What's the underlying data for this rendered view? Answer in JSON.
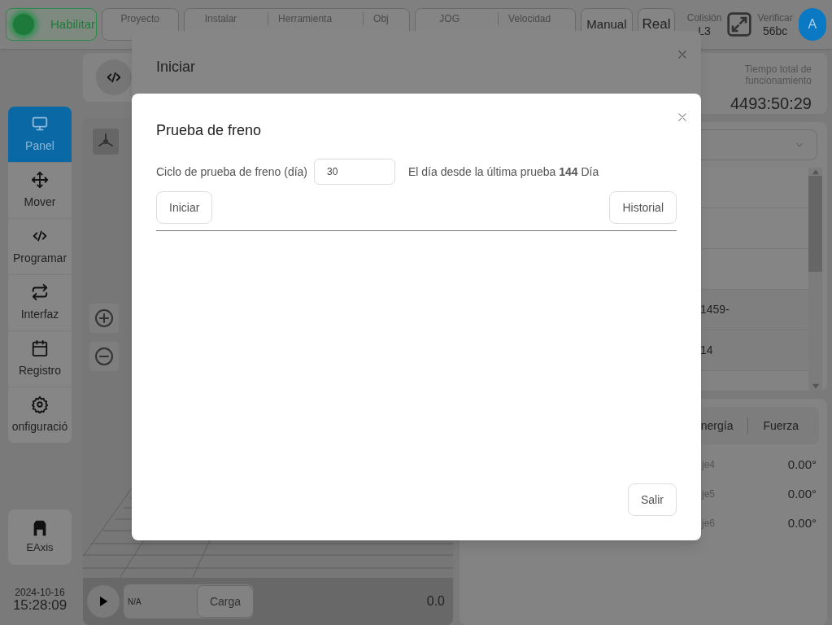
{
  "top_bar": {
    "enable_button": {
      "label": "Habilitar"
    },
    "status_groups": [
      {
        "items": [
          {
            "label": "Proyecto"
          }
        ]
      },
      {
        "items": [
          {
            "label": "Instalar"
          },
          {
            "label": "Herramienta"
          },
          {
            "label": "Obj"
          }
        ]
      },
      {
        "items": [
          {
            "label": "JOG"
          },
          {
            "label": "Velocidad"
          }
        ]
      }
    ],
    "mode_buttons": [
      {
        "label": "Manual",
        "kind": "small"
      },
      {
        "label": "Real",
        "kind": "large"
      }
    ],
    "collision": {
      "label": "Colisión",
      "value": "L3"
    },
    "verify": {
      "label": "Verificar",
      "value": "56bc"
    },
    "avatar": "A"
  },
  "sidebar": {
    "items": [
      {
        "label": "Panel",
        "selected": true
      },
      {
        "label": "Mover",
        "selected": false
      },
      {
        "label": "Programar",
        "selected": false
      },
      {
        "label": "Interfaz",
        "selected": false
      },
      {
        "label": "Registro",
        "selected": false
      },
      {
        "label": "onfiguració",
        "selected": false
      }
    ],
    "extra_axis": "EAxis",
    "date": "2024-10-16",
    "time": "15:28:09"
  },
  "viewer": {
    "player": {
      "field": "N/A",
      "load_button": "Carga",
      "reading": "0.0"
    }
  },
  "runtime": {
    "label": "Tiempo total de funcionamiento",
    "value": "4493:50:29"
  },
  "list": {
    "rows": [
      {
        "text": "1459-"
      },
      {
        "text": "14"
      }
    ]
  },
  "joint_panel": {
    "tabs": [
      {
        "label": "nergía"
      },
      {
        "label": "Fuerza"
      }
    ],
    "joints": [
      {
        "name": "je4",
        "value": "0.00°"
      },
      {
        "name": "je5",
        "value": "0.00°"
      },
      {
        "name": "je6",
        "value": "0.00°"
      }
    ]
  },
  "background_dialog": {
    "title": "Iniciar"
  },
  "dialog": {
    "title": "Prueba de freno",
    "cycle_label": "Ciclo de prueba de freno (día)",
    "cycle_value": "30",
    "last_test": "El día desde la última prueba **144** Día",
    "start_button": "Iniciar",
    "history_button": "Historial",
    "exit_button": "Salir"
  }
}
